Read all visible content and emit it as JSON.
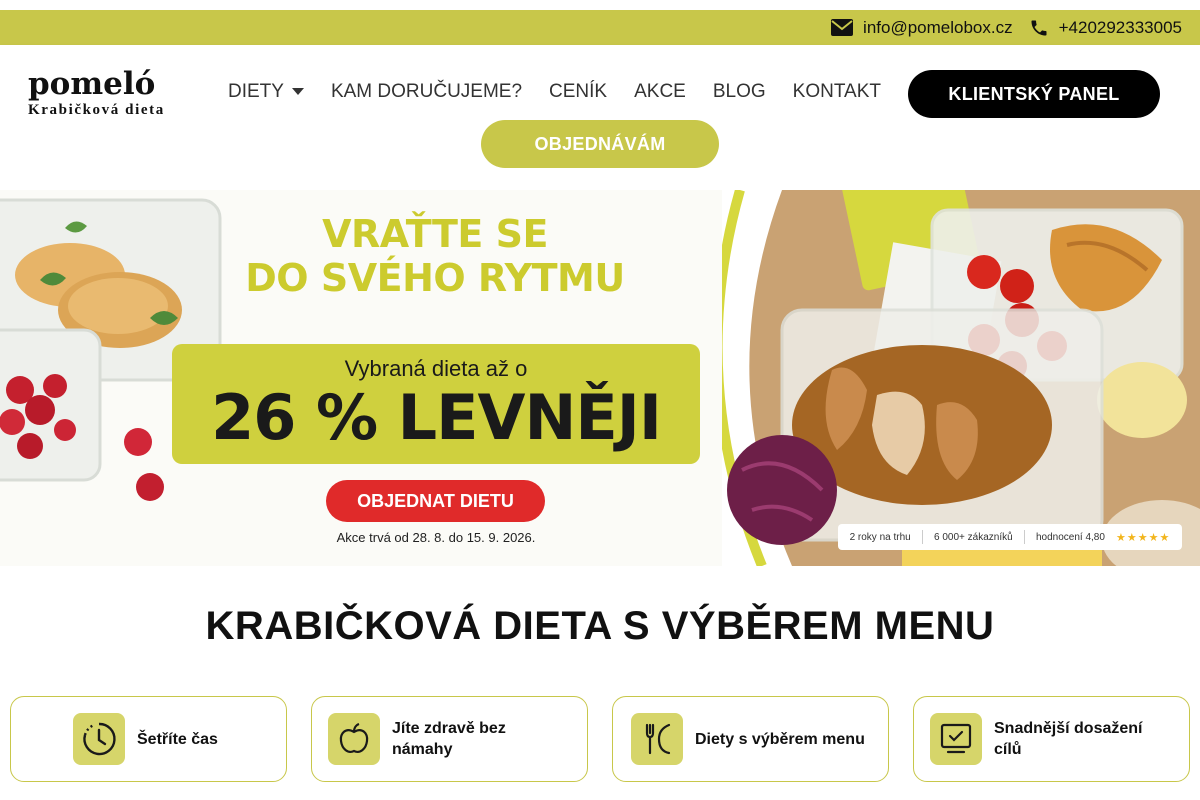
{
  "topbar": {
    "email": "info@pomelobox.cz",
    "phone": "+420292333005",
    "email_icon": "envelope-icon",
    "phone_icon": "phone-icon"
  },
  "logo": {
    "word": "pomeló",
    "tagline": "Krabičková dieta"
  },
  "nav": {
    "items": [
      {
        "label": "DIETY",
        "has_dropdown": true
      },
      {
        "label": "KAM DORUČUJEME?"
      },
      {
        "label": "CENÍK"
      },
      {
        "label": "AKCE"
      },
      {
        "label": "BLOG"
      },
      {
        "label": "KONTAKT"
      }
    ],
    "client_panel": "KLIENTSKÝ PANEL",
    "order": "OBJEDNÁVÁM"
  },
  "hero": {
    "title_line1": "VRAŤTE SE",
    "title_line2": "DO SVÉHO RYTMU",
    "subtitle": "Vybraná dieta až o",
    "discount": "26 % LEVNĚJI",
    "cta": "OBJEDNAT DIETU",
    "note": "Akce trvá od 28. 8. do 15. 9. 2026.",
    "badge": {
      "years": "2 roky na trhu",
      "customers": "6 000+ zákazníků",
      "rating": "hodnocení 4,80",
      "stars": "★★★★★"
    }
  },
  "section": {
    "title": "KRABIČKOVÁ DIETA S VÝBĚREM MENU"
  },
  "features": [
    {
      "label": "Šetříte čas",
      "icon": "clock-icon"
    },
    {
      "label": "Jíte zdravě bez námahy",
      "icon": "apple-icon"
    },
    {
      "label": "Diety s výběrem menu",
      "icon": "cutlery-icon"
    },
    {
      "label": "Snadnější dosažení cílů",
      "icon": "monitor-check-icon"
    }
  ],
  "colors": {
    "accent": "#c8c74a",
    "cta_red": "#e02a2a",
    "dark": "#000000"
  }
}
